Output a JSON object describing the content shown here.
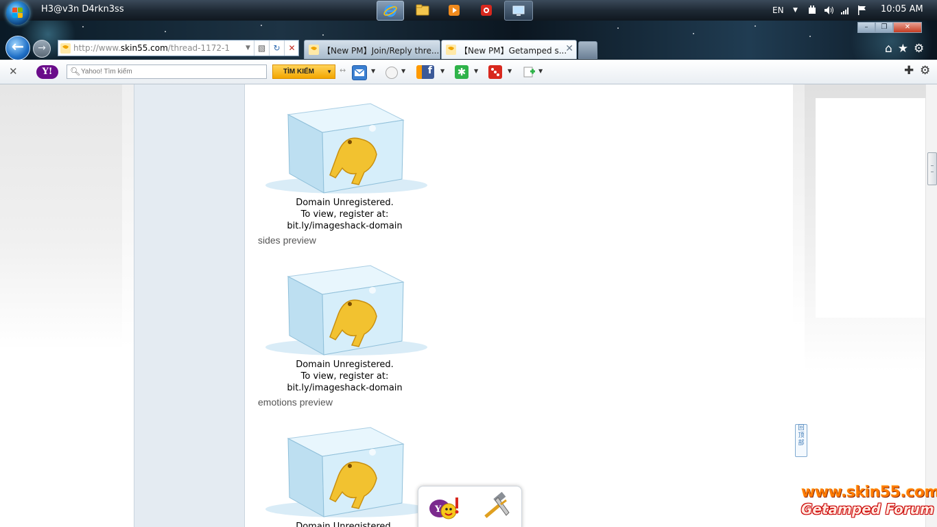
{
  "taskbar": {
    "user_name": "H3@v3n D4rkn3ss",
    "apps": [
      {
        "name": "internet-explorer",
        "active": true
      },
      {
        "name": "file-explorer",
        "active": false
      },
      {
        "name": "media-player",
        "active": false
      },
      {
        "name": "red-app",
        "active": false
      },
      {
        "name": "remote-desktop",
        "active": false
      }
    ],
    "language": "EN",
    "clock": "10:05 AM"
  },
  "browser": {
    "address": {
      "url_prefix": "http://www.",
      "url_domain": "skin55.com",
      "url_path": "/thread-1172-1"
    },
    "tabs": [
      {
        "label": "【New PM】Join/Reply thre..."
      },
      {
        "label": "【New PM】Getamped s..."
      }
    ],
    "window_close": "✕"
  },
  "yahoo_toolbar": {
    "logo": "Y!",
    "search_placeholder": "Yahoo! Tìm kiếm",
    "search_button": "TÌM KIẾM"
  },
  "page": {
    "images": [
      {
        "caption_lines": [
          "Domain Unregistered.",
          "To view, register at:",
          "bit.ly/imageshack-domain"
        ],
        "label": "sides preview"
      },
      {
        "caption_lines": [
          "Domain Unregistered.",
          "To view, register at:",
          "bit.ly/imageshack-domain"
        ],
        "label": "emotions preview"
      },
      {
        "caption_lines": [
          "Domain Unregistered."
        ],
        "label": ""
      }
    ],
    "back_to_top": "回顶部"
  },
  "watermark": {
    "url": "www.skin55.com",
    "forum": "Getamped Forum"
  },
  "colors": {
    "accent_orange": "#ff7a00",
    "yahoo_purple": "#6a0c8a",
    "post_side_bg": "#e4ebf2"
  }
}
